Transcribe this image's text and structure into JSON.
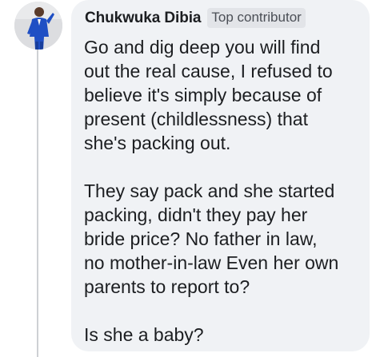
{
  "comment": {
    "author": "Chukwuka Dibia",
    "badge": "Top contributor",
    "avatar_icon": "profile-photo-man-in-blue-suit",
    "text": "Go and dig deep you will find\nout the real cause,  I refused to\nbelieve it's simply because of\npresent  (childlessness) that\nshe's packing out.\n\nThey say pack and she started\npacking,  didn't they pay her\nbride price? No father in law,\nno mother-in-law  Even her own\nparents to report to?\n\nIs she a baby?"
  },
  "colors": {
    "bubble_background": "#f0f2f5",
    "badge_background": "#e2e4e8",
    "text": "#1c1e21",
    "thread_line": "#ced0d4",
    "suit_blue": "#1f4fc4"
  }
}
